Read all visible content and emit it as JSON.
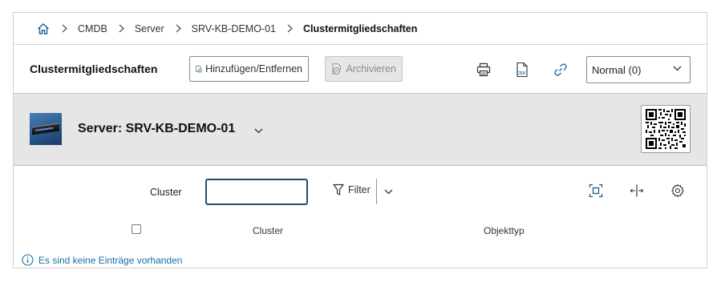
{
  "breadcrumb": {
    "home_icon": "home-icon",
    "items": [
      "CMDB",
      "Server",
      "SRV-KB-DEMO-01",
      "Clustermitgliedschaften"
    ]
  },
  "toolbar": {
    "title": "Clustermitgliedschaften",
    "add_remove_label": "Hinzufügen/Entfernen",
    "archive_label": "Archivieren",
    "print_icon": "printer-icon",
    "csv_icon": "csv-icon",
    "link_icon": "link-icon",
    "view_select": "Normal (0)"
  },
  "object": {
    "title": "Server: SRV-KB-DEMO-01",
    "image_icon": "server-image",
    "qr_icon": "qr-code-icon"
  },
  "filter": {
    "label": "Cluster",
    "value": "",
    "filter_label": "Filter"
  },
  "table": {
    "columns": [
      "Cluster",
      "Objekttyp"
    ]
  },
  "empty_message": "Es sind keine Einträge vorhanden",
  "colors": {
    "accent": "#1f4f73",
    "info": "#1a6fa3",
    "header_bg": "#e6e6e6"
  }
}
